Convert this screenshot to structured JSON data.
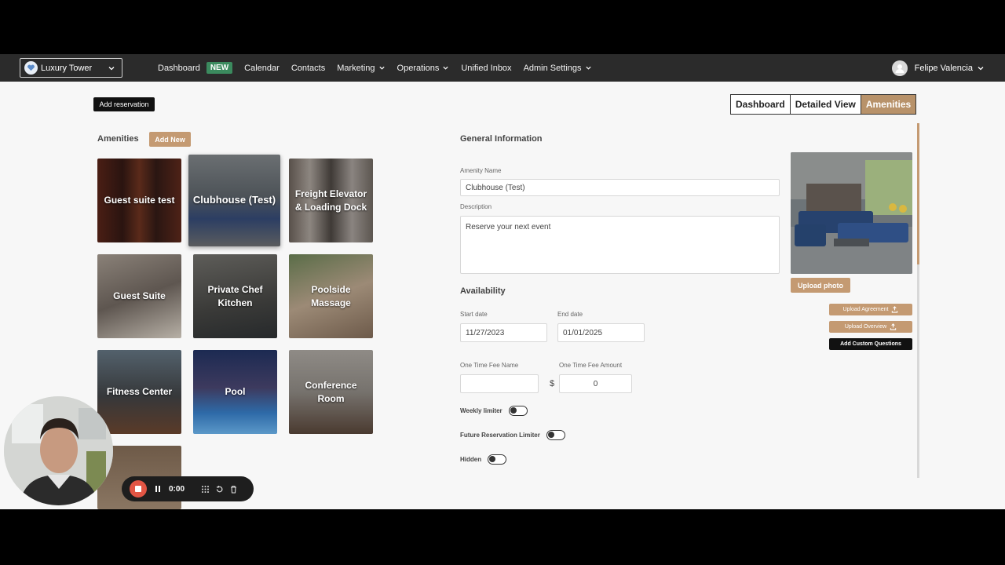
{
  "nav": {
    "property": "Luxury Tower",
    "items": [
      {
        "label": "Dashboard",
        "badge": "NEW"
      },
      {
        "label": "Calendar"
      },
      {
        "label": "Contacts"
      },
      {
        "label": "Marketing",
        "dropdown": true
      },
      {
        "label": "Operations",
        "dropdown": true
      },
      {
        "label": "Unified Inbox"
      },
      {
        "label": "Admin Settings",
        "dropdown": true
      }
    ],
    "user": "Felipe Valencia"
  },
  "add_reservation": "Add reservation",
  "view_tabs": [
    "Dashboard",
    "Detailed View",
    "Amenities"
  ],
  "amenities": {
    "title": "Amenities",
    "add_new": "Add New",
    "tiles": [
      "Guest suite test",
      "Clubhouse (Test)",
      "Freight Elevator & Loading Dock",
      "Guest Suite",
      "Private Chef Kitchen",
      "Poolside Massage",
      "Fitness Center",
      "Pool",
      "Conference Room"
    ]
  },
  "form": {
    "general_title": "General Information",
    "name_label": "Amenity Name",
    "name_value": "Clubhouse (Test)",
    "desc_label": "Description",
    "desc_value": "Reserve your next event",
    "availability_title": "Availability",
    "start_label": "Start date",
    "start_value": "11/27/2023",
    "end_label": "End date",
    "end_value": "01/01/2025",
    "fee_name_label": "One Time Fee Name",
    "fee_amount_label": "One Time Fee Amount",
    "currency": "$",
    "fee_amount_value": "0",
    "weekly_limiter": "Weekly limiter",
    "future_limiter": "Future Reservation Limiter",
    "hidden": "Hidden"
  },
  "side": {
    "upload_photo": "Upload photo",
    "upload_agreement": "Upload Agreement",
    "upload_overview": "Upload Overview",
    "custom_questions": "Add Custom Questions"
  },
  "recorder": {
    "time": "0:00"
  },
  "colors": {
    "accent": "#c49a72",
    "nav_bg": "#2b2b2b",
    "new_badge": "#3b8a5e"
  }
}
